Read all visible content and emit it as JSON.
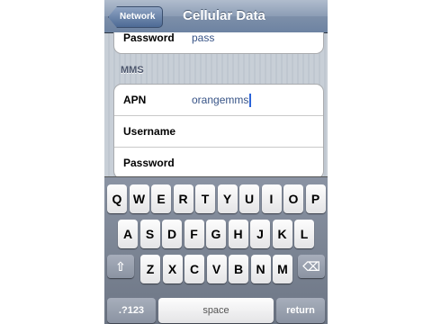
{
  "nav": {
    "back_label": "Network",
    "title": "Cellular Data"
  },
  "top_group": {
    "password_label": "Password",
    "password_value": "pass"
  },
  "mms": {
    "header": "MMS",
    "apn_label": "APN",
    "apn_value": "orangemms",
    "username_label": "Username",
    "password_label": "Password"
  },
  "keyboard": {
    "row1": [
      "Q",
      "W",
      "E",
      "R",
      "T",
      "Y",
      "U",
      "I",
      "O",
      "P"
    ],
    "row2": [
      "A",
      "S",
      "D",
      "F",
      "G",
      "H",
      "J",
      "K",
      "L"
    ],
    "row3": [
      "Z",
      "X",
      "C",
      "V",
      "B",
      "N",
      "M"
    ],
    "shift": "⇧",
    "delete": "⌫",
    "numbers": ".?123",
    "space": "space",
    "return": "return"
  }
}
